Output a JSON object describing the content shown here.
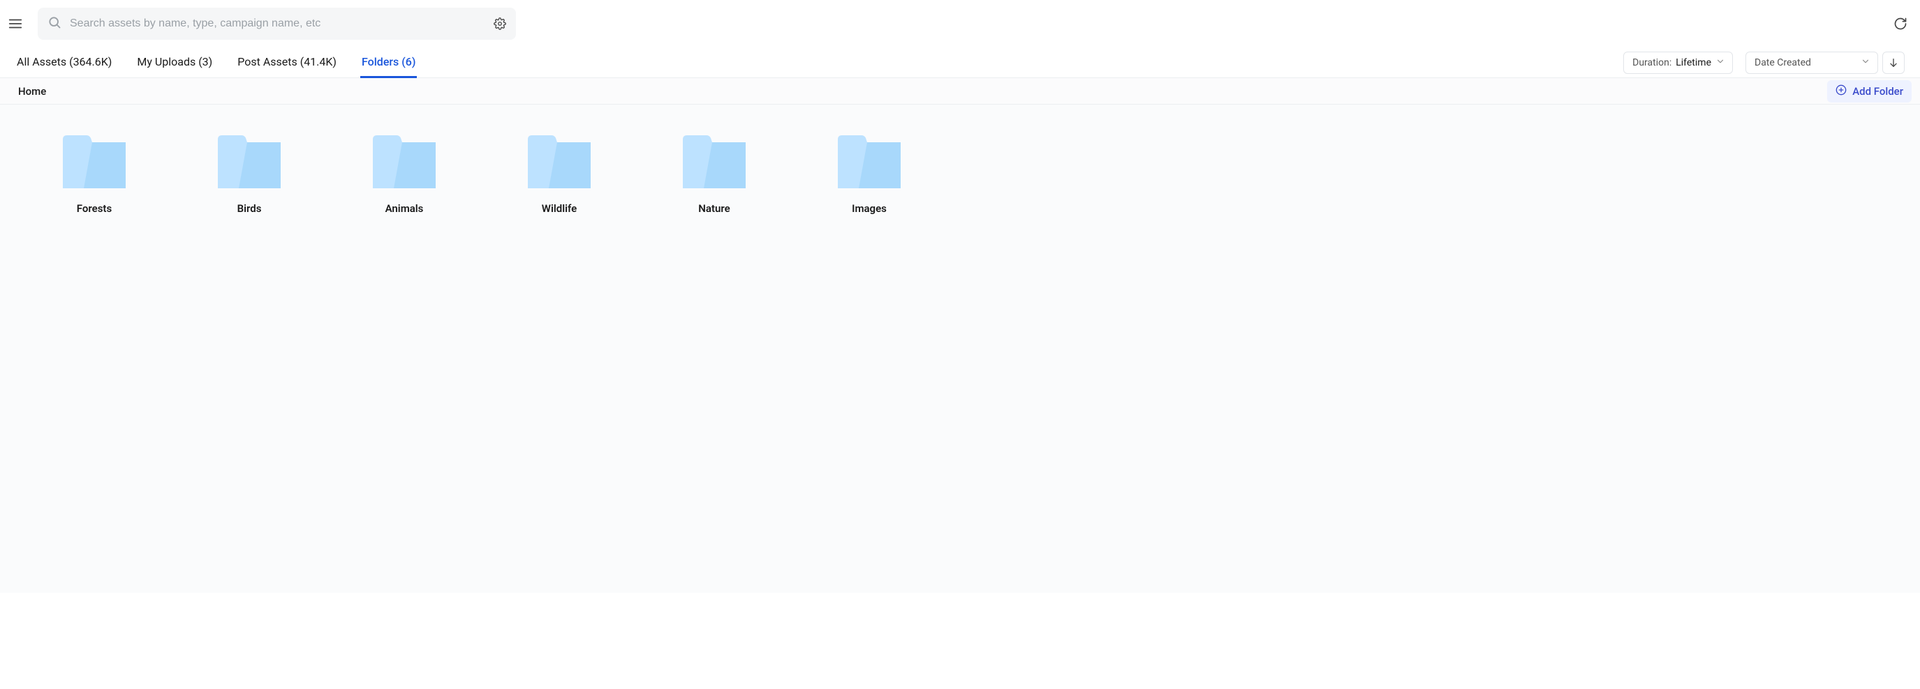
{
  "search": {
    "placeholder": "Search assets by name, type, campaign name, etc"
  },
  "tabs": [
    {
      "label": "All Assets (364.6K)",
      "active": false
    },
    {
      "label": "My Uploads (3)",
      "active": false
    },
    {
      "label": "Post Assets (41.4K)",
      "active": false
    },
    {
      "label": "Folders (6)",
      "active": true
    }
  ],
  "duration": {
    "prefix": "Duration:",
    "value": "Lifetime"
  },
  "sort": {
    "selected": "Date Created"
  },
  "breadcrumb": {
    "path": "Home"
  },
  "add_folder_label": "Add Folder",
  "folders": [
    {
      "name": "Forests"
    },
    {
      "name": "Birds"
    },
    {
      "name": "Animals"
    },
    {
      "name": "Wildlife"
    },
    {
      "name": "Nature"
    },
    {
      "name": "Images"
    }
  ],
  "colors": {
    "accent": "#1a56db",
    "folder_light": "#bde2ff",
    "folder_dark": "#a8d8fb"
  }
}
